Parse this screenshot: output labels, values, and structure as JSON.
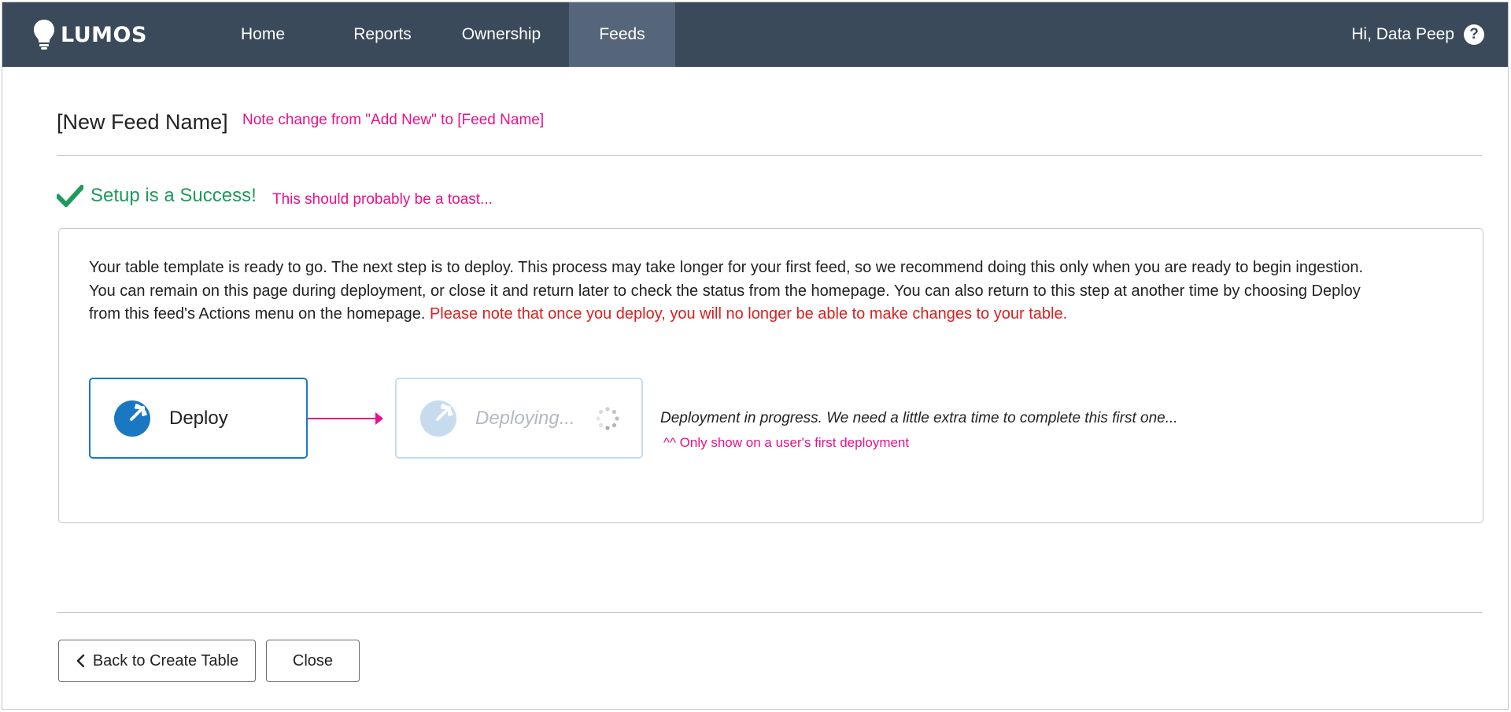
{
  "navbar": {
    "logo_text": "LUMOS",
    "items": [
      {
        "label": "Home",
        "active": false
      },
      {
        "label": "Reports",
        "active": false
      },
      {
        "label": "Ownership",
        "active": false
      },
      {
        "label": "Feeds",
        "active": true
      }
    ],
    "user_greeting": "Hi, Data Peep",
    "help_icon": "question-circle-icon",
    "colors": {
      "background": "#3b4a5a",
      "active_tab": "#56667a"
    }
  },
  "page": {
    "title": "[New Feed Name]",
    "title_note": "Note change from \"Add New\" to [Feed Name]"
  },
  "success": {
    "icon": "check-icon",
    "message": "Setup is a Success!",
    "note": "This should probably be a toast..."
  },
  "panel": {
    "description": "Your table template is ready to go. The next step is to deploy. This process may take longer for your first feed, so we recommend doing this only when you are ready to begin ingestion. You can remain on this page during deployment, or close it and return later to check the status from the homepage. You can also return to this step at another time by choosing Deploy from this feed's Actions menu on the homepage.",
    "warning": "Please note that once you deploy, you will no longer be able to make changes to your table.",
    "deploy_label": "Deploy",
    "deploying_label": "Deploying...",
    "progress_message": "Deployment in progress. We need a little extra time to complete this first one...",
    "progress_note": "^^ Only show on a user's first deployment"
  },
  "footer": {
    "back_label": "Back to Create Table",
    "close_label": "Close"
  },
  "colors": {
    "annotation": "#e8118a",
    "success": "#1e9a5a",
    "warning": "#d9201f",
    "primary": "#1a78c2"
  }
}
